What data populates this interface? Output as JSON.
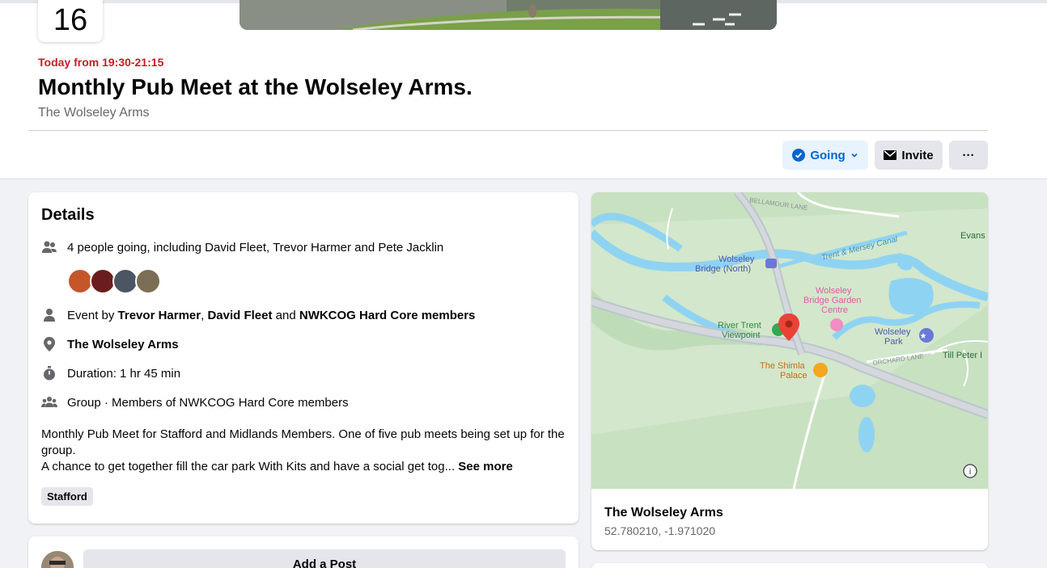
{
  "event": {
    "day": "16",
    "time": "Today from 19:30-21:15",
    "title": "Monthly Pub Meet at the Wolseley Arms.",
    "venue": "The Wolseley Arms"
  },
  "actions": {
    "going_label": "Going",
    "invite_label": "Invite",
    "more_label": "···"
  },
  "details": {
    "heading": "Details",
    "going_text": "4 people going, including David Fleet, Trevor Harmer and Pete Jacklin",
    "event_by_prefix": "Event by",
    "host1": "Trevor Harmer",
    "sep1": ",",
    "host2": "David Fleet",
    "and_word": "and",
    "host3": "NWKCOG Hard Core members",
    "location": "The Wolseley Arms",
    "duration": "Duration: 1 hr 45 min",
    "group": "Group · Members of NWKCOG Hard Core members",
    "description_line1": "Monthly Pub Meet for Stafford and Midlands Members. One of five pub meets being set up for the group.",
    "description_line2": "A chance to get together fill the car park With Kits and have a social get tog...",
    "see_more": "See more",
    "tag": "Stafford"
  },
  "map": {
    "labels": {
      "bellamour": "BELLAMOUR LANE",
      "evans": "Evans",
      "canal": "Trent & Mersey Canal",
      "bridge_north_1": "Wolseley",
      "bridge_north_2": "Bridge (North)",
      "garden_1": "Wolseley",
      "garden_2": "Bridge Garden",
      "garden_3": "Centre",
      "viewpoint_1": "River Trent",
      "viewpoint_2": "Viewpoint",
      "park_1": "Wolseley",
      "park_2": "Park",
      "orchard": "ORCHARD LANE",
      "till_peter": "Till Peter I",
      "shimla_1": "The Shimla",
      "shimla_2": "Palace"
    },
    "place_name": "The Wolseley Arms",
    "coords": "52.780210, -1.971020"
  },
  "post": {
    "add_label": "Add a Post"
  },
  "colors": {
    "accent": "#0064d1",
    "time_red": "#c81d25",
    "map_land": "#c8e1c1",
    "map_water": "#8fd3f2",
    "pin_red": "#ea4335"
  }
}
